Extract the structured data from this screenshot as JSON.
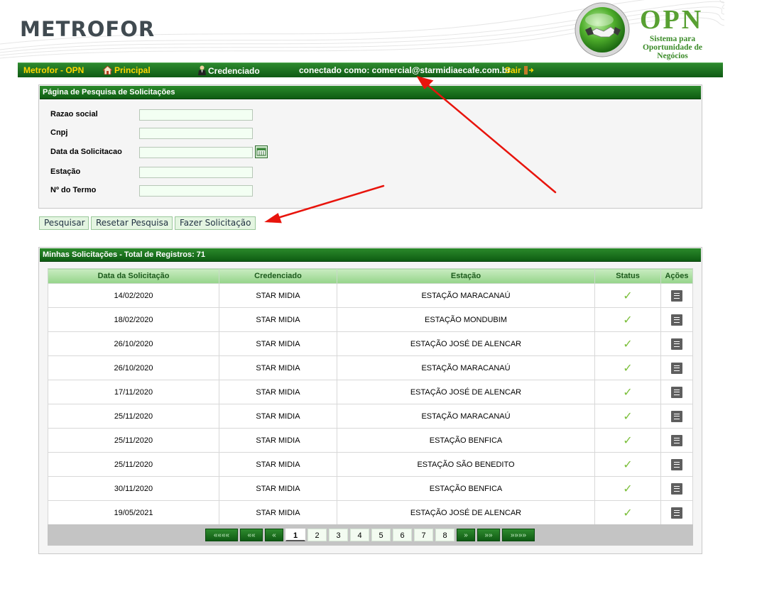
{
  "header": {
    "brand": "METROFOR",
    "opn_title": "OPN",
    "opn_subtitle_1": "Sistema para",
    "opn_subtitle_2": "Oportunidade de Negócios"
  },
  "nav": {
    "brand": "Metrofor - OPN",
    "home": "Principal",
    "accredited": "Credenciado",
    "connected_as": "conectado como: comercial@starmidiaecafe.com.br",
    "logout": "Sair"
  },
  "search": {
    "title": "Página de Pesquisa de Solicitações",
    "fields": [
      {
        "label": "Razao social",
        "value": ""
      },
      {
        "label": "Cnpj",
        "value": ""
      },
      {
        "label": "Data da Solicitacao",
        "value": ""
      },
      {
        "label": "Estação",
        "value": ""
      },
      {
        "label": "Nº do Termo",
        "value": ""
      }
    ],
    "buttons": {
      "search": "Pesquisar",
      "reset": "Resetar Pesquisa",
      "request": "Fazer Solicitação"
    }
  },
  "results": {
    "title": "Minhas Solicitações - Total de Registros: 71",
    "columns": [
      "Data da Solicitação",
      "Credenciado",
      "Estação",
      "Status",
      "Ações"
    ],
    "rows": [
      [
        "14/02/2020",
        "STAR MIDIA",
        "ESTAÇÃO MARACANAÚ"
      ],
      [
        "18/02/2020",
        "STAR MIDIA",
        "ESTAÇÃO MONDUBIM"
      ],
      [
        "26/10/2020",
        "STAR MIDIA",
        "ESTAÇÃO JOSÉ DE ALENCAR"
      ],
      [
        "26/10/2020",
        "STAR MIDIA",
        "ESTAÇÃO MARACANAÚ"
      ],
      [
        "17/11/2020",
        "STAR MIDIA",
        "ESTAÇÃO JOSÉ DE ALENCAR"
      ],
      [
        "25/11/2020",
        "STAR MIDIA",
        "ESTAÇÃO MARACANAÚ"
      ],
      [
        "25/11/2020",
        "STAR MIDIA",
        "ESTAÇÃO BENFICA"
      ],
      [
        "25/11/2020",
        "STAR MIDIA",
        "ESTAÇÃO SÃO BENEDITO"
      ],
      [
        "30/11/2020",
        "STAR MIDIA",
        "ESTAÇÃO BENFICA"
      ],
      [
        "19/05/2021",
        "STAR MIDIA",
        "ESTAÇÃO JOSÉ DE ALENCAR"
      ]
    ],
    "status_symbol": "✓"
  },
  "pager": {
    "first": "««««",
    "prev_fast": "««",
    "prev": "«",
    "pages": [
      "1",
      "2",
      "3",
      "4",
      "5",
      "6",
      "7",
      "8"
    ],
    "current": "1",
    "next": "»",
    "next_fast": "»»",
    "last": "»»»»"
  },
  "colors": {
    "nav_green": "#0f5a14",
    "nav_link": "#ffd700",
    "header_green": "#95d48a",
    "annotation_red": "#e8140c"
  }
}
